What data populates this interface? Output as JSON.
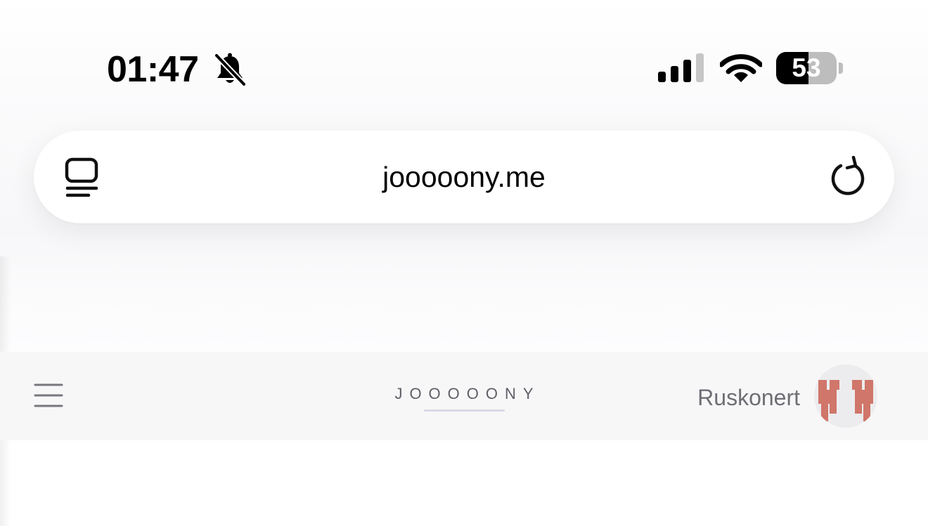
{
  "status_bar": {
    "time": "01:47",
    "battery_level": "53",
    "battery_fraction": 0.53,
    "icons": [
      "bell-slash-icon",
      "cellular-signal-icon",
      "wifi-icon",
      "battery-icon"
    ]
  },
  "address_bar": {
    "url": "jooooony.me",
    "left_icon": "reader-view-icon",
    "right_icon": "reload-icon"
  },
  "site_header": {
    "menu_icon": "hamburger-menu-icon",
    "logo": "JOOOOONY",
    "username": "Ruskonert",
    "avatar_color": "#d0766a"
  },
  "colors": {
    "header_background": "#f7f7f8",
    "logo_text": "#5f6068",
    "username_text": "#6e6e74"
  }
}
